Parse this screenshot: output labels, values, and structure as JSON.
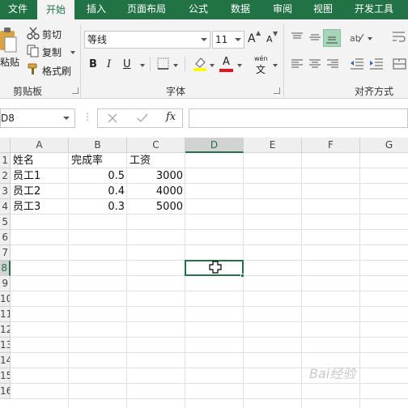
{
  "tabs": [
    "文件",
    "开始",
    "插入",
    "页面布局",
    "公式",
    "数据",
    "审阅",
    "视图",
    "开发工具"
  ],
  "active_tab": "开始",
  "clipboard": {
    "paste_label": "粘贴",
    "cut_label": "剪切",
    "copy_label": "复制",
    "format_painter_label": "格式刷",
    "group_label": "剪贴板"
  },
  "font": {
    "font_name": "等线",
    "font_size": "11",
    "bold_label": "B",
    "italic_label": "I",
    "underline_label": "U",
    "grow_label": "A",
    "shrink_label": "A",
    "color_label": "A",
    "wen_top": "wén",
    "wen_bottom": "文",
    "group_label": "字体"
  },
  "alignment": {
    "group_label": "对齐方式"
  },
  "formula_bar": {
    "name_box": "D8",
    "fx_label": "fx",
    "content": ""
  },
  "columns": [
    "A",
    "B",
    "C",
    "D",
    "E",
    "F",
    "G"
  ],
  "selected_column": "D",
  "rows": [
    "1",
    "2",
    "3",
    "4",
    "5",
    "6",
    "7",
    "8",
    "9",
    "10",
    "11",
    "12",
    "13",
    "14",
    "15",
    "16"
  ],
  "selected_row": "8",
  "table": {
    "headers": [
      "姓名",
      "完成率",
      "工资"
    ],
    "rows": [
      [
        "员工1",
        "0.5",
        "3000"
      ],
      [
        "员工2",
        "0.4",
        "4000"
      ],
      [
        "员工3",
        "0.3",
        "5000"
      ]
    ]
  },
  "watermark": "Bai经验",
  "colors": {
    "accent": "#217346",
    "fill_highlight": "#ffff00",
    "font_color": "#e81123"
  }
}
